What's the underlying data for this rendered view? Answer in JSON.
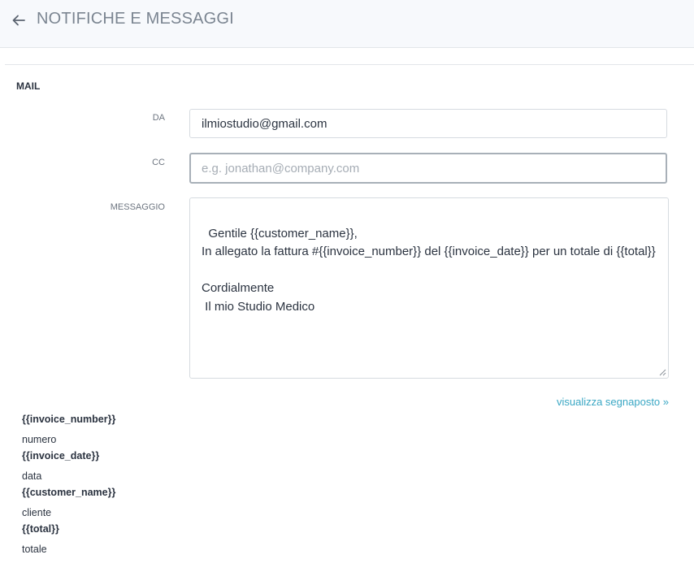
{
  "header": {
    "title": "NOTIFICHE E MESSAGGI",
    "back_icon": "arrow-left-icon"
  },
  "section": {
    "label": "MAIL"
  },
  "form": {
    "from": {
      "label": "DA",
      "value": "ilmiostudio@gmail.com"
    },
    "cc": {
      "label": "CC",
      "value": "",
      "placeholder": "e.g. jonathan@company.com"
    },
    "message": {
      "label": "MESSAGGIO",
      "value": "Gentile {{customer_name}},\nIn allegato la fattura #{{invoice_number}} del {{invoice_date}} per un totale di {{total}}\n\nCordialmente\n Il mio Studio Medico"
    }
  },
  "placeholders_link": "visualizza segnaposto »",
  "placeholders": [
    {
      "token": "{{invoice_number}}",
      "description": "numero"
    },
    {
      "token": "{{invoice_date}}",
      "description": "data"
    },
    {
      "token": "{{customer_name}}",
      "description": "cliente"
    },
    {
      "token": "{{total}}",
      "description": "totale"
    }
  ],
  "colors": {
    "accent_link": "#3aa7c4",
    "header_bg": "#f7f9fc"
  }
}
